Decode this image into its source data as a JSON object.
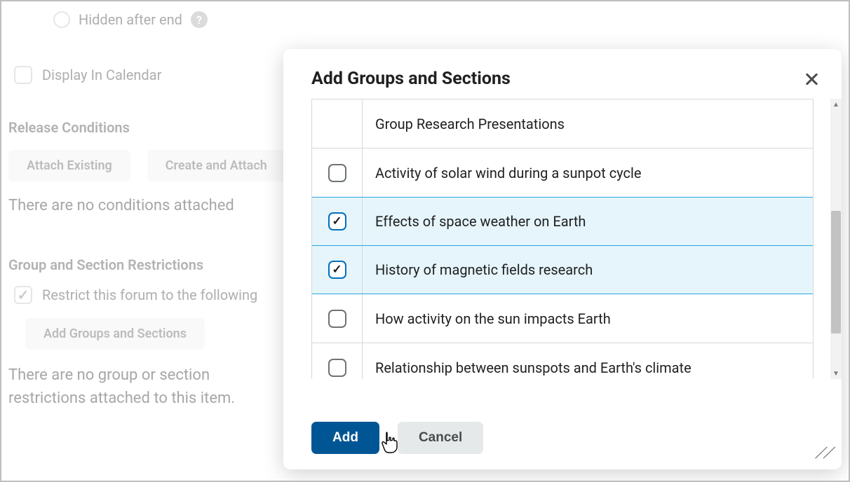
{
  "background": {
    "radio_label": "Hidden after end",
    "display_in_calendar": "Display In Calendar",
    "release_heading": "Release Conditions",
    "attach_existing": "Attach Existing",
    "create_and_attach": "Create and Attach",
    "no_conditions": "There are no conditions attached",
    "group_heading": "Group and Section Restrictions",
    "restrict_label": "Restrict this forum to the following",
    "add_groups_btn": "Add Groups and Sections",
    "no_groups": "There are no group or section restrictions attached to this item."
  },
  "modal": {
    "title": "Add Groups and Sections",
    "header_label": "Group Research Presentations",
    "items": [
      {
        "label": "Activity of solar wind during a sunpot cycle",
        "checked": false
      },
      {
        "label": "Effects of space weather on Earth",
        "checked": true
      },
      {
        "label": "History of magnetic fields research",
        "checked": true
      },
      {
        "label": "How activity on the sun impacts Earth",
        "checked": false
      },
      {
        "label": "Relationship between sunspots and Earth's climate",
        "checked": false
      }
    ],
    "add_btn": "Add",
    "cancel_btn": "Cancel"
  }
}
